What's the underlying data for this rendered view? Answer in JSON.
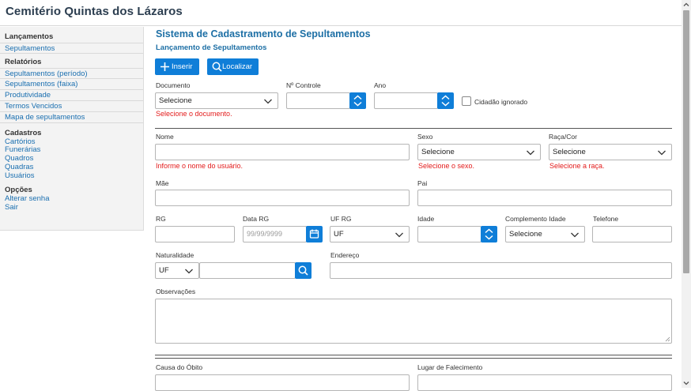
{
  "app": {
    "title": "Cemitério Quintas dos Lázaros"
  },
  "sidebar": {
    "sections": [
      {
        "title": "Lançamentos",
        "items": [
          "Sepultamentos"
        ]
      },
      {
        "title": "Relatórios",
        "items": [
          "Sepultamentos (período)",
          "Sepultamentos (faixa)",
          "Produtividade",
          "Termos Vencidos",
          "Mapa de sepultamentos"
        ]
      },
      {
        "title": "Cadastros",
        "items": [
          "Cartórios",
          "Funerárias",
          "Quadros",
          "Quadras",
          "Usuários"
        ]
      },
      {
        "title": "Opções",
        "items": [
          "Alterar senha",
          "Sair"
        ]
      }
    ]
  },
  "page": {
    "title": "Sistema de Cadastramento de Sepultamentos",
    "subtitle": "Lançamento de Sepultamentos"
  },
  "toolbar": {
    "insert_label": "Inserir",
    "search_label": "Localizar"
  },
  "form": {
    "documento": {
      "label": "Documento",
      "value": "Selecione",
      "error": "Selecione o documento."
    },
    "controle": {
      "label": "Nº Controle",
      "value": ""
    },
    "ano": {
      "label": "Ano",
      "value": ""
    },
    "cidadao": {
      "label": "Cidadão ignorado",
      "checked": false
    },
    "nome": {
      "label": "Nome",
      "value": "",
      "error": "Informe o nome do usuário."
    },
    "sexo": {
      "label": "Sexo",
      "value": "Selecione",
      "error": "Selecione o sexo."
    },
    "raca": {
      "label": "Raça/Cor",
      "value": "Selecione",
      "error": "Selecione a raça."
    },
    "mae": {
      "label": "Mãe",
      "value": ""
    },
    "pai": {
      "label": "Pai",
      "value": ""
    },
    "rg": {
      "label": "RG",
      "value": ""
    },
    "data_rg": {
      "label": "Data RG",
      "placeholder": "99/99/9999"
    },
    "uf_rg": {
      "label": "UF RG",
      "value": "UF"
    },
    "idade": {
      "label": "Idade",
      "value": ""
    },
    "complemento": {
      "label": "Complemento Idade",
      "value": "Selecione"
    },
    "telefone": {
      "label": "Telefone",
      "value": ""
    },
    "naturalidade": {
      "label": "Naturalidade",
      "uf": "UF",
      "value": ""
    },
    "endereco": {
      "label": "Endereço",
      "value": ""
    },
    "observacoes": {
      "label": "Observações",
      "value": ""
    },
    "causa": {
      "label": "Causa do Óbito",
      "value": ""
    },
    "lugar": {
      "label": "Lugar de Falecimento",
      "value": ""
    }
  },
  "colors": {
    "accent": "#0f7ed8",
    "heading": "#1d6fa5",
    "error": "#e31b1b",
    "link": "#1a6fb0"
  },
  "icons": [
    "plus-icon",
    "search-icon",
    "chevron-down-icon",
    "spinner-icon",
    "calendar-icon",
    "scroll-up-icon",
    "scroll-down-icon"
  ]
}
